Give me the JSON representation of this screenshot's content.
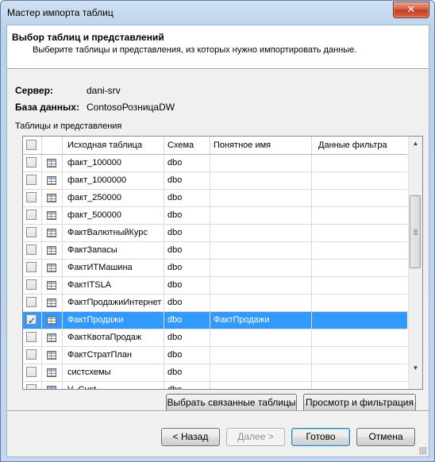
{
  "window": {
    "title": "Мастер импорта таблиц",
    "close_glyph": "✕"
  },
  "header": {
    "title": "Выбор таблиц и представлений",
    "subtitle": "Выберите таблицы и представления, из которых нужно импортировать данные."
  },
  "connection": {
    "server_label": "Сервер:",
    "server_value": "dani-srv",
    "db_label": "База данных:",
    "db_value": "ContosoРозницаDW"
  },
  "grid": {
    "caption": "Таблицы и представления",
    "columns": [
      "Исходная таблица",
      "Схема",
      "Понятное имя",
      "Данные фильтра"
    ],
    "rows": [
      {
        "checked": false,
        "source": "факт_100000",
        "schema": "dbo",
        "friendly": "",
        "filter": ""
      },
      {
        "checked": false,
        "source": "факт_1000000",
        "schema": "dbo",
        "friendly": "",
        "filter": ""
      },
      {
        "checked": false,
        "source": "факт_250000",
        "schema": "dbo",
        "friendly": "",
        "filter": ""
      },
      {
        "checked": false,
        "source": "факт_500000",
        "schema": "dbo",
        "friendly": "",
        "filter": ""
      },
      {
        "checked": false,
        "source": "ФактВалютныйКурс",
        "schema": "dbo",
        "friendly": "",
        "filter": ""
      },
      {
        "checked": false,
        "source": "ФактЗапасы",
        "schema": "dbo",
        "friendly": "",
        "filter": ""
      },
      {
        "checked": false,
        "source": "ФактИТМашина",
        "schema": "dbo",
        "friendly": "",
        "filter": ""
      },
      {
        "checked": false,
        "source": "ФактITSLA",
        "schema": "dbo",
        "friendly": "",
        "filter": ""
      },
      {
        "checked": false,
        "source": "ФактПродажиИнтернет",
        "schema": "dbo",
        "friendly": "",
        "filter": ""
      },
      {
        "checked": true,
        "source": "ФактПродажи",
        "schema": "dbo",
        "friendly": "ФактПродажи",
        "filter": "",
        "selected": true
      },
      {
        "checked": false,
        "source": "ФактКвотаПродаж",
        "schema": "dbo",
        "friendly": "",
        "filter": ""
      },
      {
        "checked": false,
        "source": "ФактСтратПлан",
        "schema": "dbo",
        "friendly": "",
        "filter": ""
      },
      {
        "checked": false,
        "source": "систсхемы",
        "schema": "dbo",
        "friendly": "",
        "filter": ""
      },
      {
        "checked": false,
        "source": "V_Cust...",
        "schema": "dbo",
        "friendly": "",
        "filter": ""
      }
    ]
  },
  "buttons": {
    "select_related": "Выбрать связанные таблицы",
    "preview_filter": "Просмотр и фильтрация",
    "back": "< Назад",
    "next": "Далее >",
    "finish": "Готово",
    "cancel": "Отмена"
  },
  "icons": {
    "scroll_up": "▲",
    "scroll_down": "▼",
    "checkmark": "✓"
  }
}
